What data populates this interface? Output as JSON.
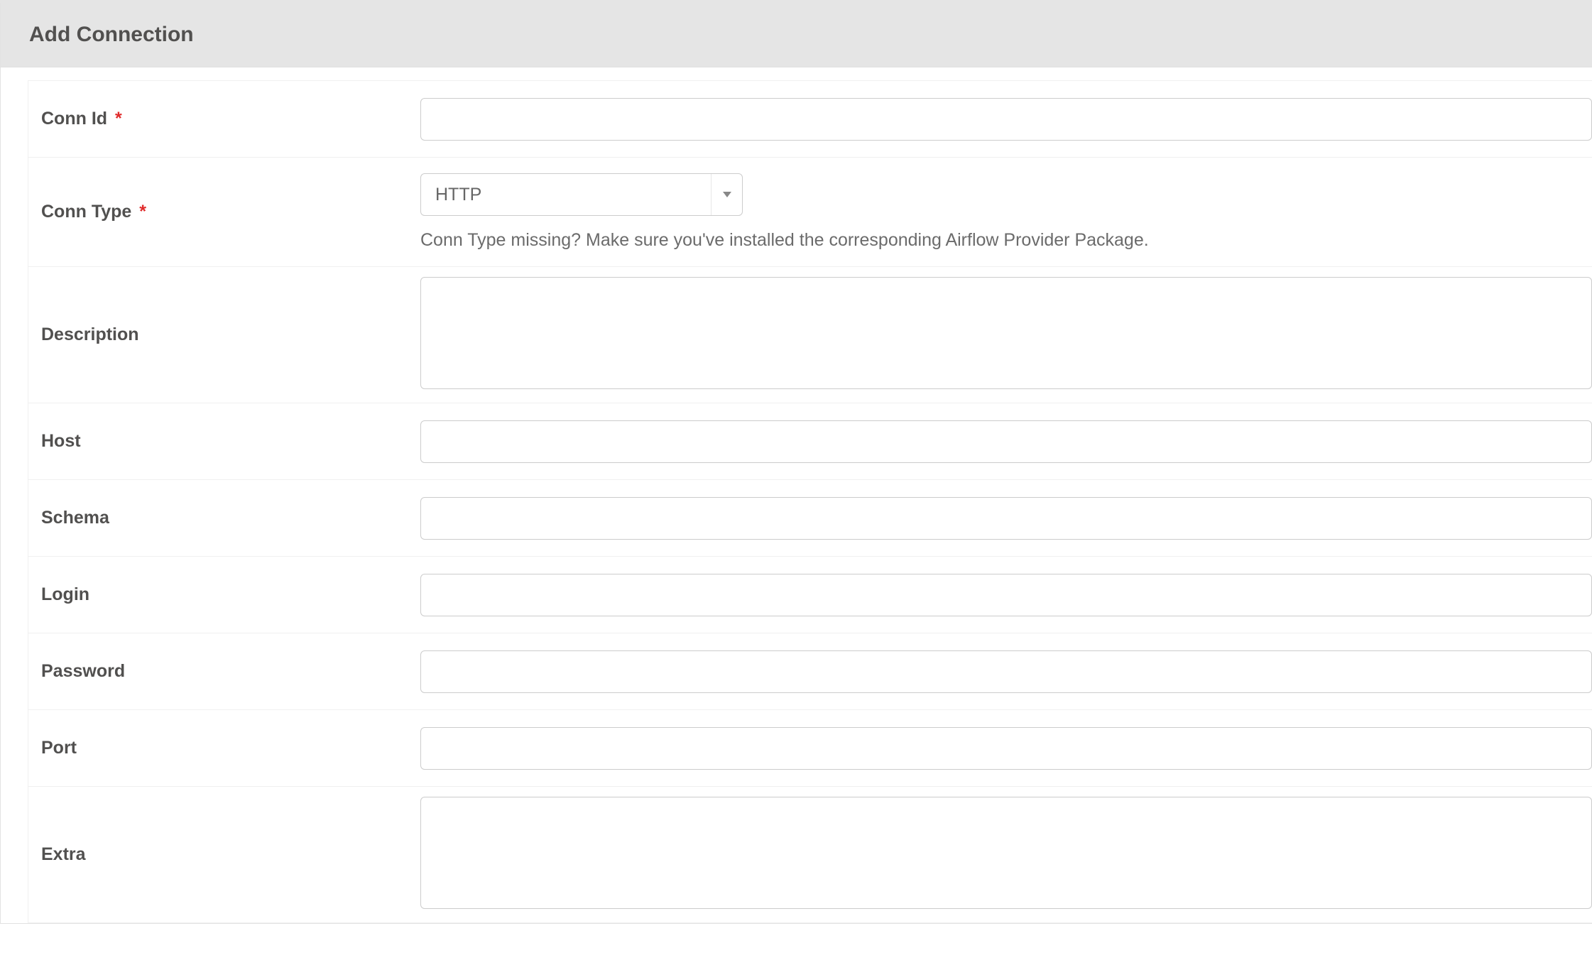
{
  "header": {
    "title": "Add Connection"
  },
  "form": {
    "conn_id": {
      "label": "Conn Id",
      "required": "*",
      "value": ""
    },
    "conn_type": {
      "label": "Conn Type",
      "required": "*",
      "selected": "HTTP",
      "helper": "Conn Type missing? Make sure you've installed the corresponding Airflow Provider Package."
    },
    "description": {
      "label": "Description",
      "value": ""
    },
    "host": {
      "label": "Host",
      "value": ""
    },
    "schema": {
      "label": "Schema",
      "value": ""
    },
    "login": {
      "label": "Login",
      "value": ""
    },
    "password": {
      "label": "Password",
      "value": ""
    },
    "port": {
      "label": "Port",
      "value": ""
    },
    "extra": {
      "label": "Extra",
      "value": ""
    }
  }
}
